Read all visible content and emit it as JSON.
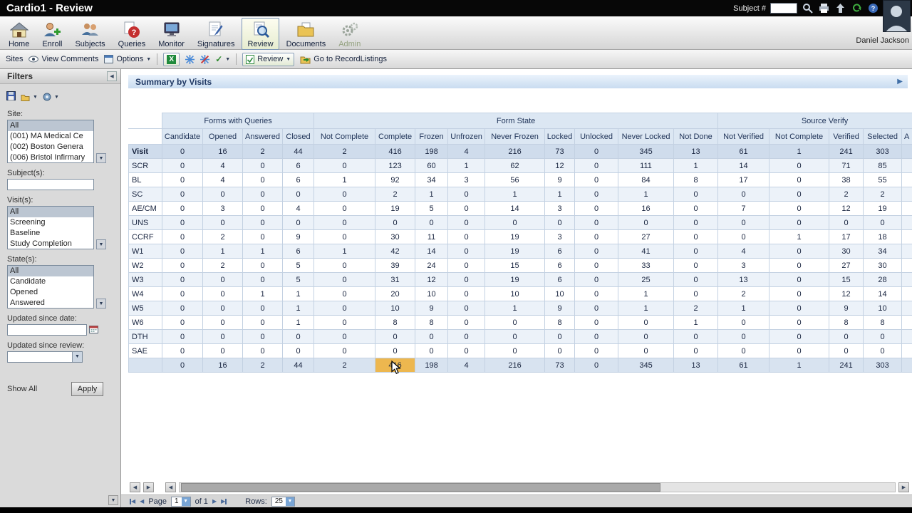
{
  "titlebar": {
    "title": "Cardio1 - Review",
    "subject_label": "Subject #",
    "subject_value": ""
  },
  "user": {
    "name": "Daniel Jackson"
  },
  "nav": {
    "items": [
      {
        "id": "home",
        "label": "Home"
      },
      {
        "id": "enroll",
        "label": "Enroll"
      },
      {
        "id": "subjects",
        "label": "Subjects"
      },
      {
        "id": "queries",
        "label": "Queries"
      },
      {
        "id": "monitor",
        "label": "Monitor"
      },
      {
        "id": "signatures",
        "label": "Signatures"
      },
      {
        "id": "review",
        "label": "Review",
        "active": true
      },
      {
        "id": "documents",
        "label": "Documents"
      },
      {
        "id": "admin",
        "label": "Admin",
        "disabled": true
      }
    ]
  },
  "toolbar": {
    "sites": "Sites",
    "view_comments": "View Comments",
    "options": "Options",
    "review": "Review",
    "goto_record_listings": "Go to RecordListings"
  },
  "filters": {
    "title": "Filters",
    "site": {
      "label": "Site:",
      "options": [
        "All",
        "(001) MA Medical Ce",
        "(002) Boston Genera",
        "(006) Bristol Infirmary"
      ],
      "selected": "All"
    },
    "subjects": {
      "label": "Subject(s):",
      "value": ""
    },
    "visits": {
      "label": "Visit(s):",
      "options": [
        "All",
        "Screening",
        "Baseline",
        "Study Completion"
      ],
      "selected": "All"
    },
    "states": {
      "label": "State(s):",
      "options": [
        "All",
        "Candidate",
        "Opened",
        "Answered"
      ],
      "selected": "All"
    },
    "updated_since_date": {
      "label": "Updated since date:",
      "value": ""
    },
    "updated_since_review": {
      "label": "Updated since review:",
      "value": ""
    },
    "show_all": "Show All",
    "apply": "Apply"
  },
  "summary": {
    "title": "Summary by Visits",
    "groups": [
      {
        "label": "",
        "span": 1
      },
      {
        "label": "Forms with Queries",
        "span": 4
      },
      {
        "label": "Form State",
        "span": 9
      },
      {
        "label": "Source Verify",
        "span": 5
      }
    ],
    "columns": [
      "",
      "Candidate",
      "Opened",
      "Answered",
      "Closed",
      "Not Complete",
      "Complete",
      "Frozen",
      "Unfrozen",
      "Never Frozen",
      "Locked",
      "Unlocked",
      "Never Locked",
      "Not Done",
      "Not Verified",
      "Not Complete",
      "Verified",
      "Selected",
      "A"
    ],
    "rows": [
      {
        "label": "Visit",
        "type": "header",
        "values": [
          0,
          16,
          2,
          44,
          2,
          416,
          198,
          4,
          216,
          73,
          0,
          345,
          13,
          61,
          1,
          241,
          303
        ]
      },
      {
        "label": "SCR",
        "values": [
          0,
          4,
          0,
          6,
          0,
          123,
          60,
          1,
          62,
          12,
          0,
          111,
          1,
          14,
          0,
          71,
          85
        ]
      },
      {
        "label": "BL",
        "values": [
          0,
          4,
          0,
          6,
          1,
          92,
          34,
          3,
          56,
          9,
          0,
          84,
          8,
          17,
          0,
          38,
          55
        ]
      },
      {
        "label": "SC",
        "values": [
          0,
          0,
          0,
          0,
          0,
          2,
          1,
          0,
          1,
          1,
          0,
          1,
          0,
          0,
          0,
          2,
          2
        ]
      },
      {
        "label": "AE/CM",
        "values": [
          0,
          3,
          0,
          4,
          0,
          19,
          5,
          0,
          14,
          3,
          0,
          16,
          0,
          7,
          0,
          12,
          19
        ]
      },
      {
        "label": "UNS",
        "values": [
          0,
          0,
          0,
          0,
          0,
          0,
          0,
          0,
          0,
          0,
          0,
          0,
          0,
          0,
          0,
          0,
          0
        ]
      },
      {
        "label": "CCRF",
        "values": [
          0,
          2,
          0,
          9,
          0,
          30,
          11,
          0,
          19,
          3,
          0,
          27,
          0,
          0,
          1,
          17,
          18
        ]
      },
      {
        "label": "W1",
        "values": [
          0,
          1,
          1,
          6,
          1,
          42,
          14,
          0,
          19,
          6,
          0,
          41,
          0,
          4,
          0,
          30,
          34
        ]
      },
      {
        "label": "W2",
        "values": [
          0,
          2,
          0,
          5,
          0,
          39,
          24,
          0,
          15,
          6,
          0,
          33,
          0,
          3,
          0,
          27,
          30
        ]
      },
      {
        "label": "W3",
        "values": [
          0,
          0,
          0,
          5,
          0,
          31,
          12,
          0,
          19,
          6,
          0,
          25,
          0,
          13,
          0,
          15,
          28
        ]
      },
      {
        "label": "W4",
        "values": [
          0,
          0,
          1,
          1,
          0,
          20,
          10,
          0,
          10,
          10,
          0,
          1,
          0,
          2,
          0,
          12,
          14
        ]
      },
      {
        "label": "W5",
        "values": [
          0,
          0,
          0,
          1,
          0,
          10,
          9,
          0,
          1,
          9,
          0,
          1,
          2,
          1,
          0,
          9,
          10
        ]
      },
      {
        "label": "W6",
        "values": [
          0,
          0,
          0,
          1,
          0,
          8,
          8,
          0,
          0,
          8,
          0,
          0,
          1,
          0,
          0,
          8,
          8
        ]
      },
      {
        "label": "DTH",
        "values": [
          0,
          0,
          0,
          0,
          0,
          0,
          0,
          0,
          0,
          0,
          0,
          0,
          0,
          0,
          0,
          0,
          0
        ]
      },
      {
        "label": "SAE",
        "values": [
          0,
          0,
          0,
          0,
          0,
          0,
          0,
          0,
          0,
          0,
          0,
          0,
          0,
          0,
          0,
          0,
          0
        ]
      },
      {
        "label": "",
        "type": "total",
        "values": [
          0,
          16,
          2,
          44,
          2,
          416,
          198,
          4,
          216,
          73,
          0,
          345,
          13,
          61,
          1,
          241,
          303
        ]
      }
    ],
    "highlighted_cell": {
      "row_index": 15,
      "value_index": 5,
      "column": "Complete",
      "value": 416,
      "color": "#edb74f"
    }
  },
  "pager": {
    "page_label": "Page",
    "page_value": "1",
    "of_text": "of 1",
    "rows_label": "Rows:",
    "rows_value": "25"
  },
  "icons": {
    "collapse_left": "◀",
    "expand_right": "▶",
    "dropdown": "▼",
    "prev": "◀",
    "next": "▶",
    "check": "✓",
    "excel": "X"
  },
  "colors": {
    "highlight_cell": "#edb74f",
    "table_header_blue": "#dce7f3",
    "accent_blue": "#3f6ea6"
  }
}
